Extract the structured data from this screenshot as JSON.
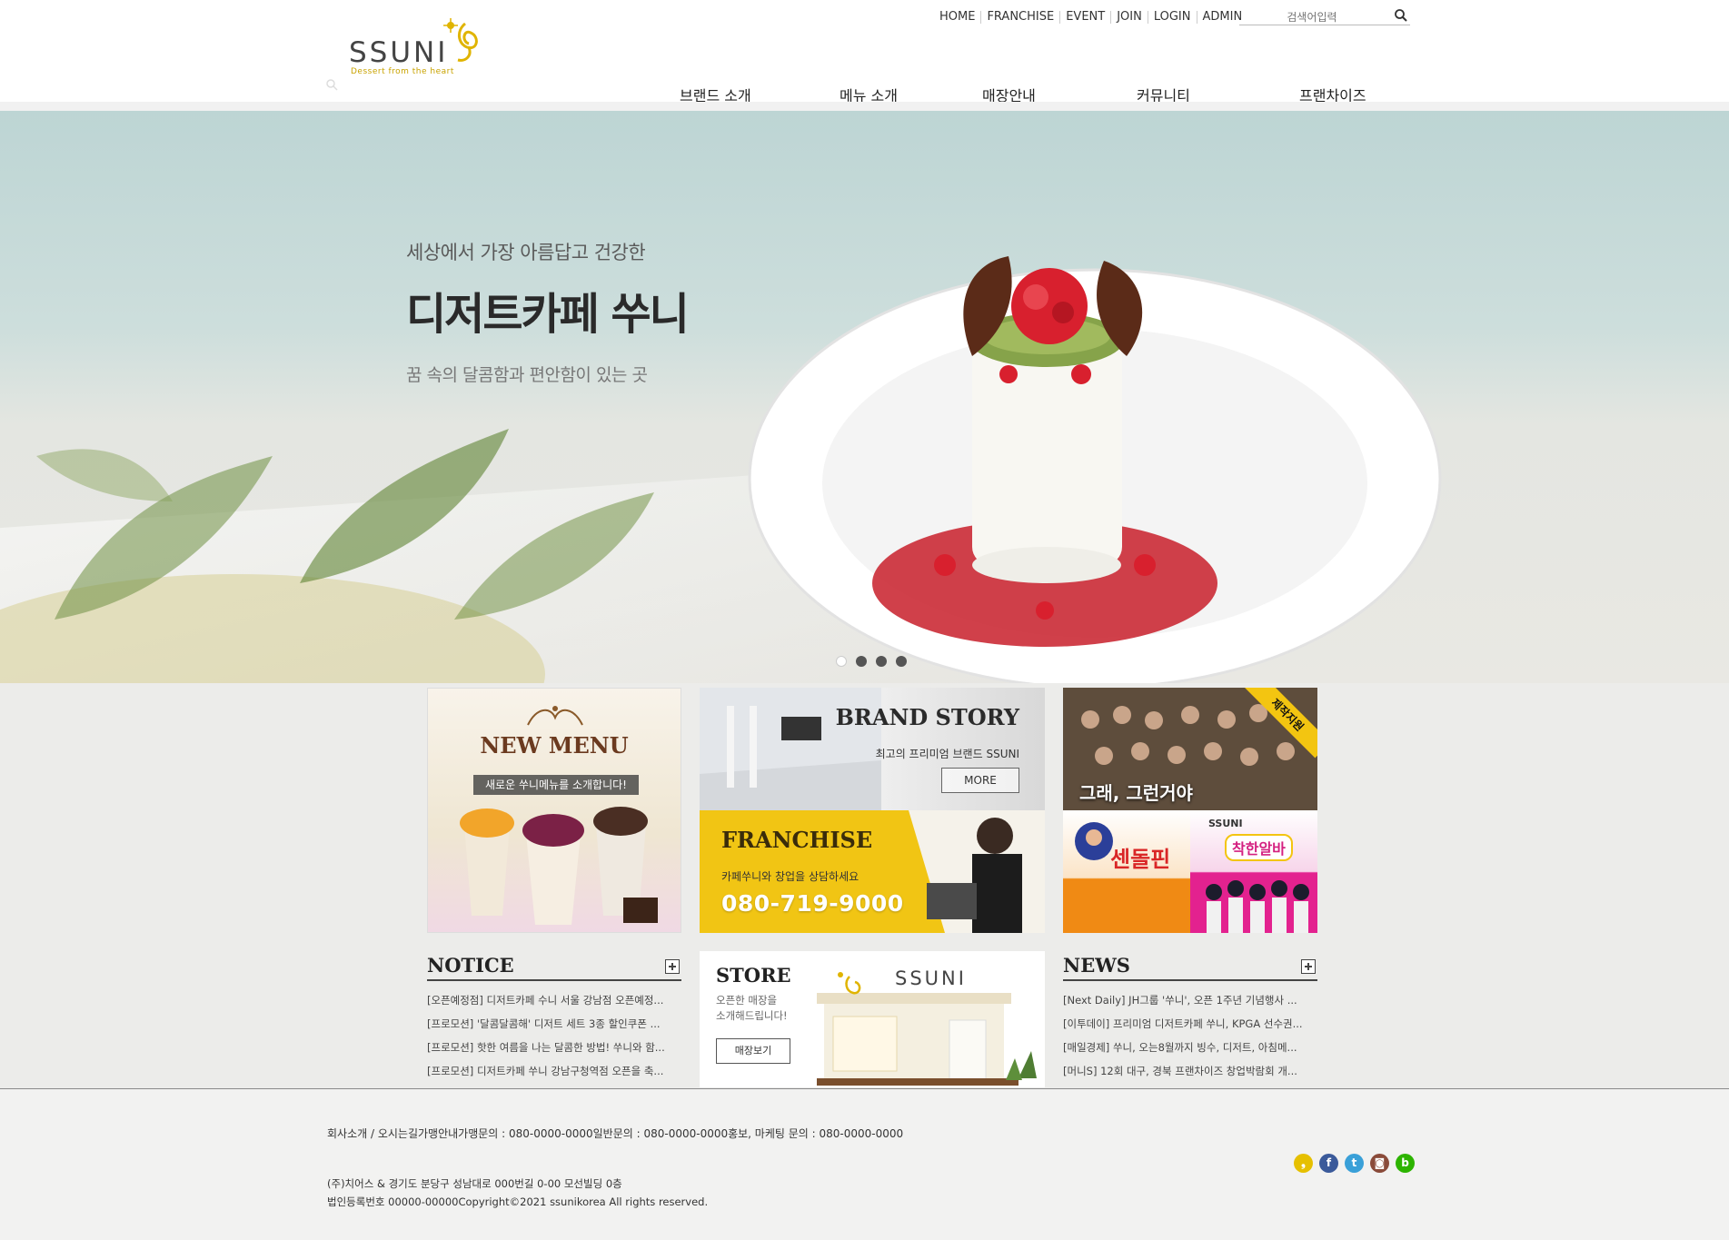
{
  "brand": {
    "logo_text": "SSUNI",
    "tagline": "Dessert from the heart"
  },
  "util_nav": [
    "HOME",
    "FRANCHISE",
    "EVENT",
    "JOIN",
    "LOGIN",
    "ADMIN"
  ],
  "search": {
    "placeholder": "검색어입력"
  },
  "main_nav": [
    "브랜드 소개",
    "메뉴 소개",
    "매장안내",
    "커뮤니티",
    "프랜차이즈"
  ],
  "hero": {
    "subtitle": "세상에서 가장 아름답고 건강한",
    "title": "디저트카페 쑤니",
    "description": "꿈 속의 달콤함과 편안함이 있는 곳",
    "slides": 4,
    "active_slide": 1
  },
  "new_menu": {
    "title": "NEW MENU",
    "subtitle": "새로운 쑤니메뉴를 소개합니다!"
  },
  "brand_story": {
    "title": "BRAND STORY",
    "description": "최고의 프리미엄 브랜드 SSUNI",
    "more_label": "MORE"
  },
  "franchise_tile": {
    "title": "FRANCHISE",
    "description": "카페쑤니와 창업을 상담하세요",
    "phone": "080-719-9000"
  },
  "event1": {
    "caption": "그래, 그런거야",
    "ribbon": "제작지원"
  },
  "event2": {
    "name": "센돌핀",
    "brand": "SSUNI",
    "tag": "착한알바"
  },
  "notice": {
    "title": "NOTICE",
    "items": [
      "[오픈예정점] 디저트카페 수니 서울 강남점 오픈예정...",
      "[프로모션] '달콤달콤해' 디저트 세트 3종 할인쿠폰 ...",
      "[프로모션] 핫한 여름을 나는 달콤한 방법! 쑤니와 함...",
      "[프로모션] 디저트카페 쑤니 강남구청역점 오픈을 축..."
    ]
  },
  "store": {
    "title": "STORE",
    "description": "오픈한 매장을\n소개해드립니다!",
    "button_label": "매장보기",
    "sign": "SSUNI"
  },
  "news": {
    "title": "NEWS",
    "items": [
      "[Next Daily] JH그룹 '쑤니', 오픈 1주년 기념행사 ...",
      "[이투데이] 프리미엄 디저트카페 쑤니, KPGA 선수권...",
      "[매일경제] 쑤니, 오는8월까지 빙수, 디저트, 아침메...",
      "[머니S] 12회 대구, 경북 프랜차이즈 창업박람회 개..."
    ]
  },
  "footer": {
    "contact": "회사소개 / 오시는길가맹안내가맹문의 : 080-0000-0000일반문의 : 080-0000-0000홍보, 마케팅 문의 : 080-0000-0000",
    "address": "(주)치어스 & 경기도 분당구 성남대로 000번길 0-00 모선빌딩 0층",
    "copyright": "법인등록번호 00000-00000Copyright©2021 ssunikorea All rights reserved."
  },
  "social": [
    {
      "name": "kakaostory-icon",
      "glyph": "❟",
      "color": "#e6c000"
    },
    {
      "name": "facebook-icon",
      "glyph": "f",
      "color": "#3b5a9a"
    },
    {
      "name": "twitter-icon",
      "glyph": "t",
      "color": "#3aa0d8"
    },
    {
      "name": "instagram-icon",
      "glyph": "◙",
      "color": "#8a4b3a"
    },
    {
      "name": "blog-icon",
      "glyph": "b",
      "color": "#2db400"
    }
  ]
}
